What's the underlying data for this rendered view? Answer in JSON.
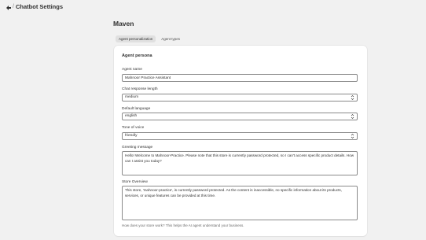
{
  "header": {
    "icon": "app-icon",
    "separator": "/",
    "title": "Chatbot Settings"
  },
  "agent": {
    "name_heading": "Maven"
  },
  "tabs": [
    {
      "label": "Agent personalization",
      "active": true
    },
    {
      "label": "Agent types",
      "active": false
    }
  ],
  "persona": {
    "section_title": "Agent persona",
    "agent_name": {
      "label": "Agent name",
      "value": "Mahnoor Practice Assistant"
    },
    "response_length": {
      "label": "Chat response length",
      "value": "medium"
    },
    "language": {
      "label": "Default language",
      "value": "english"
    },
    "tone": {
      "label": "Tone of voice",
      "value": "friendly"
    },
    "greeting": {
      "label": "Greeting message",
      "value": "Hello! Welcome to Mahnoor-Practice. Please note that this store is currently password protected, so I can't access specific product details. How can I assist you today?"
    },
    "overview": {
      "label": "Store Overview",
      "value": "This store, 'mahnoor-practice', is currently password protected. As the content is inaccessible, no specific information about its products, services, or unique features can be provided at this time.",
      "help": "How does your store work? This helps the AI agent understand your business."
    }
  },
  "colors": {
    "background": "#f1f1f1",
    "card": "#ffffff",
    "active_tab": "#e0e0e0",
    "text": "#303030"
  }
}
